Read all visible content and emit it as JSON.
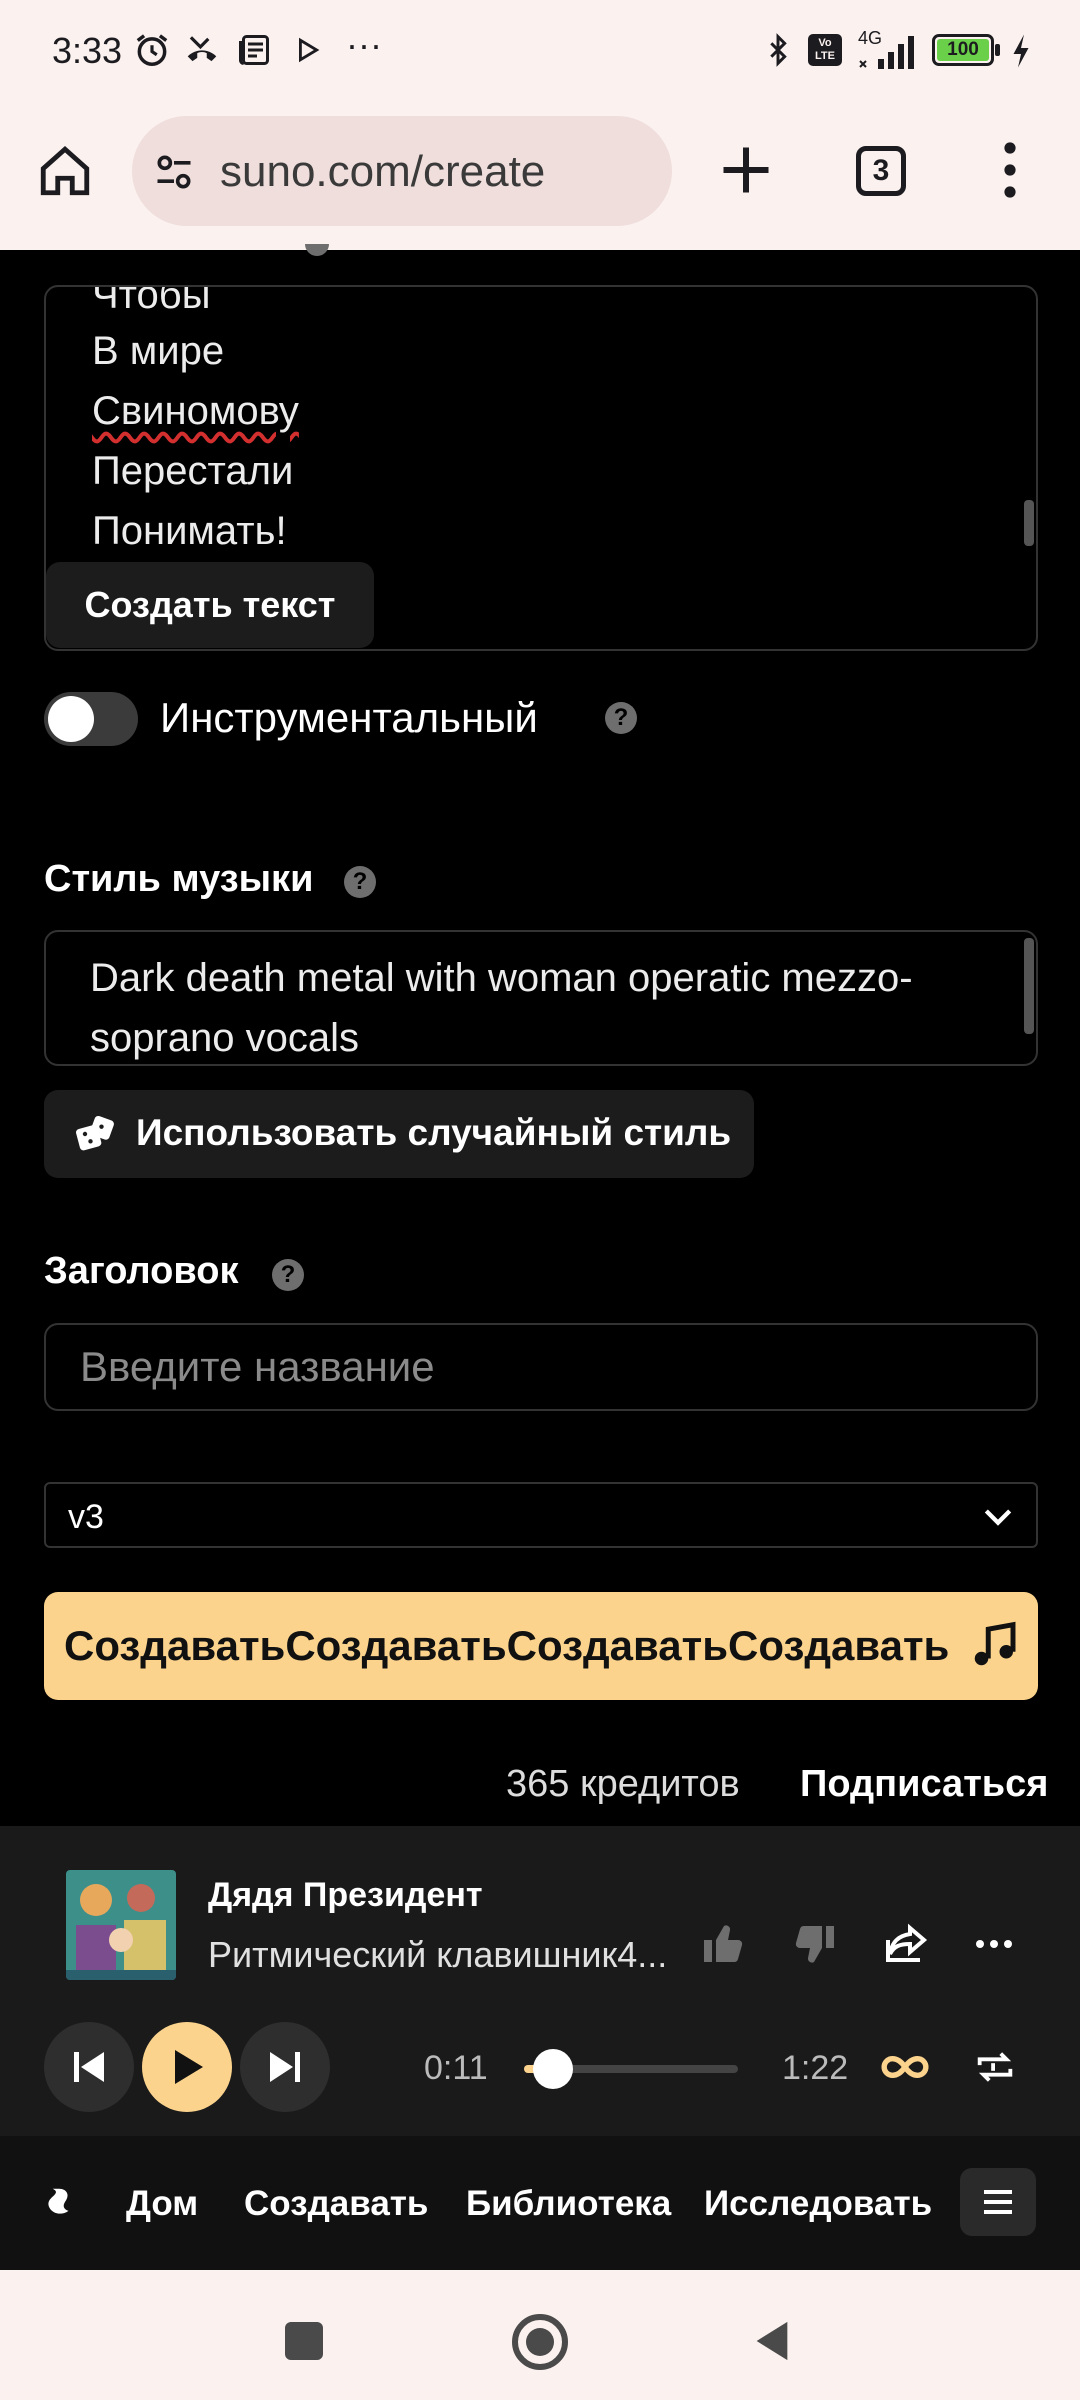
{
  "status_bar": {
    "time": "3:33",
    "battery": "100",
    "network": "4G",
    "volte": "Vo LTE",
    "more": "···"
  },
  "browser": {
    "url": "suno.com/create",
    "tab_count": "3"
  },
  "lyrics": {
    "lines": [
      "Чтобы",
      "В мире",
      "Свиномову",
      "Перестали",
      "Понимать!"
    ],
    "generate_button": "Создать текст"
  },
  "instrumental": {
    "label": "Инструментальный",
    "enabled": false
  },
  "style": {
    "label": "Стиль музыки",
    "value": "Dark death metal with woman operatic mezzo-soprano vocals",
    "random_button": "Использовать случайный стиль"
  },
  "title_field": {
    "label": "Заголовок",
    "placeholder": "Введите название"
  },
  "version": {
    "selected": "v3"
  },
  "create_button": {
    "label": "СоздаватьСоздаватьСоздаватьСоздавать"
  },
  "account": {
    "credits": "365 кредитов",
    "subscribe": "Подписаться"
  },
  "player": {
    "title": "Дядя Президент",
    "subtitle": "Ритмический клавишник4...",
    "current_time": "0:11",
    "total_time": "1:22",
    "progress": 0.134
  },
  "bottom_nav": {
    "items": [
      "Дом",
      "Создавать",
      "Библиотека",
      "Исследовать"
    ]
  },
  "colors": {
    "accent": "#fbd38d",
    "background": "#000000",
    "chrome": "#fbf1ef"
  }
}
